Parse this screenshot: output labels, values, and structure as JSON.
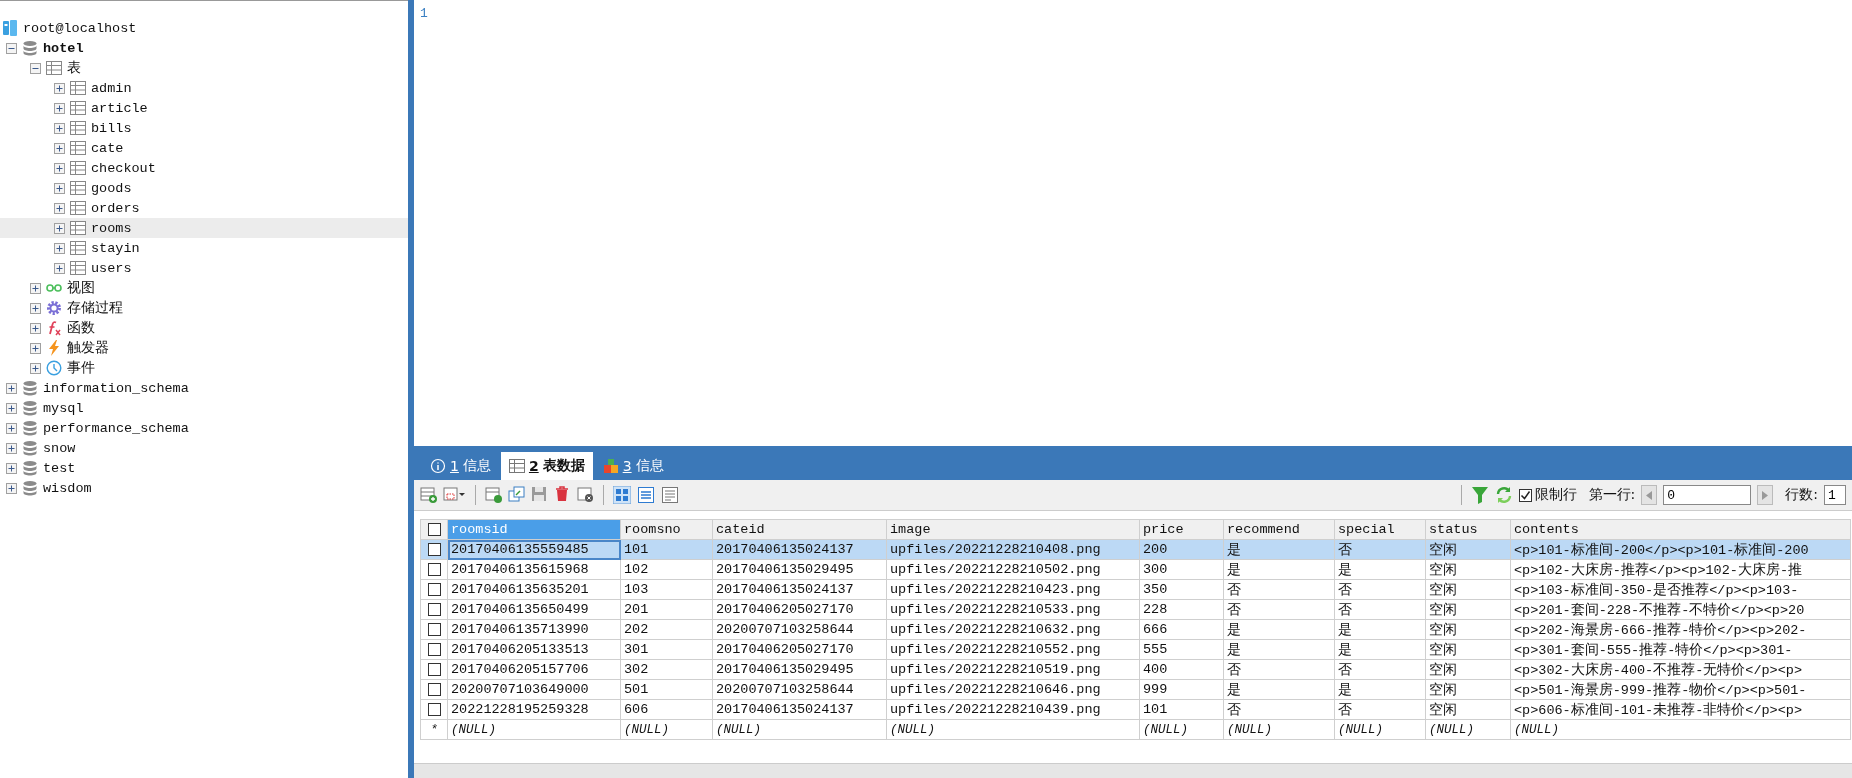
{
  "sidebar": {
    "tree": [
      {
        "kind": "connection",
        "label": "root@localhost",
        "selected": false,
        "children": [
          {
            "kind": "database",
            "label": "hotel",
            "open": true,
            "expanded": true,
            "selected": false,
            "children": [
              {
                "kind": "tables",
                "label": "表",
                "expanded": true,
                "selected": false,
                "children": [
                  {
                    "kind": "table",
                    "label": "admin",
                    "expanded": false,
                    "selected": false
                  },
                  {
                    "kind": "table",
                    "label": "article",
                    "expanded": false,
                    "selected": false
                  },
                  {
                    "kind": "table",
                    "label": "bills",
                    "expanded": false,
                    "selected": false
                  },
                  {
                    "kind": "table",
                    "label": "cate",
                    "expanded": false,
                    "selected": false
                  },
                  {
                    "kind": "table",
                    "label": "checkout",
                    "expanded": false,
                    "selected": false
                  },
                  {
                    "kind": "table",
                    "label": "goods",
                    "expanded": false,
                    "selected": false
                  },
                  {
                    "kind": "table",
                    "label": "orders",
                    "expanded": false,
                    "selected": false
                  },
                  {
                    "kind": "table",
                    "label": "rooms",
                    "expanded": false,
                    "selected": true
                  },
                  {
                    "kind": "table",
                    "label": "stayin",
                    "expanded": false,
                    "selected": false
                  },
                  {
                    "kind": "table",
                    "label": "users",
                    "expanded": false,
                    "selected": false
                  }
                ]
              },
              {
                "kind": "views",
                "label": "视图",
                "expanded": false,
                "selected": false
              },
              {
                "kind": "procedures",
                "label": "存储过程",
                "expanded": false,
                "selected": false
              },
              {
                "kind": "functions",
                "label": "函数",
                "expanded": false,
                "selected": false
              },
              {
                "kind": "triggers",
                "label": "触发器",
                "expanded": false,
                "selected": false
              },
              {
                "kind": "events",
                "label": "事件",
                "expanded": false,
                "selected": false
              }
            ]
          },
          {
            "kind": "database",
            "label": "information_schema",
            "open": false,
            "expanded": false,
            "selected": false
          },
          {
            "kind": "database",
            "label": "mysql",
            "open": false,
            "expanded": false,
            "selected": false
          },
          {
            "kind": "database",
            "label": "performance_schema",
            "open": false,
            "expanded": false,
            "selected": false
          },
          {
            "kind": "database",
            "label": "snow",
            "open": false,
            "expanded": false,
            "selected": false
          },
          {
            "kind": "database",
            "label": "test",
            "open": false,
            "expanded": false,
            "selected": false
          },
          {
            "kind": "database",
            "label": "wisdom",
            "open": false,
            "expanded": false,
            "selected": false
          }
        ]
      }
    ]
  },
  "editor": {
    "line_numbers": [
      "1"
    ]
  },
  "result_tabs": [
    {
      "kind": "info",
      "key": "1",
      "label": "信息",
      "selected": false
    },
    {
      "kind": "data",
      "key": "2",
      "label": "表数据",
      "selected": true
    },
    {
      "kind": "profile",
      "key": "3",
      "label": "信息",
      "selected": false
    }
  ],
  "toolbar": {
    "limit_rows": {
      "label": "限制行",
      "checked": true
    },
    "first_row": {
      "label": "第一行:",
      "value": "0"
    },
    "row_count": {
      "label": "行数:",
      "value": "1"
    }
  },
  "grid": {
    "all_checked": false,
    "columns": [
      {
        "label": "roomsid",
        "selected": true
      },
      {
        "label": "roomsno",
        "selected": false
      },
      {
        "label": "cateid",
        "selected": false
      },
      {
        "label": "image",
        "selected": false
      },
      {
        "label": "price",
        "selected": false
      },
      {
        "label": "recommend",
        "selected": false
      },
      {
        "label": "special",
        "selected": false
      },
      {
        "label": "status",
        "selected": false
      },
      {
        "label": "contents",
        "selected": false
      }
    ],
    "rows": [
      {
        "selected": true,
        "checked": false,
        "cells": [
          "20170406135559485",
          "101",
          "20170406135024137",
          "upfiles/20221228210408.png",
          "200",
          "是",
          "否",
          "空闲",
          "<p>101-标准间-200</p><p>101-标准间-200"
        ]
      },
      {
        "selected": false,
        "checked": false,
        "cells": [
          "20170406135615968",
          "102",
          "20170406135029495",
          "upfiles/20221228210502.png",
          "300",
          "是",
          "是",
          "空闲",
          "<p>102-大床房-推荐</p><p>102-大床房-推"
        ]
      },
      {
        "selected": false,
        "checked": false,
        "cells": [
          "20170406135635201",
          "103",
          "20170406135024137",
          "upfiles/20221228210423.png",
          "350",
          "否",
          "否",
          "空闲",
          "<p>103-标准间-350-是否推荐</p><p>103-"
        ]
      },
      {
        "selected": false,
        "checked": false,
        "cells": [
          "20170406135650499",
          "201",
          "20170406205027170",
          "upfiles/20221228210533.png",
          "228",
          "否",
          "否",
          "空闲",
          "<p>201-套间-228-不推荐-不特价</p><p>20"
        ]
      },
      {
        "selected": false,
        "checked": false,
        "cells": [
          "20170406135713990",
          "202",
          "20200707103258644",
          "upfiles/20221228210632.png",
          "666",
          "是",
          "是",
          "空闲",
          "<p>202-海景房-666-推荐-特价</p><p>202-"
        ]
      },
      {
        "selected": false,
        "checked": false,
        "cells": [
          "20170406205133513",
          "301",
          "20170406205027170",
          "upfiles/20221228210552.png",
          "555",
          "是",
          "是",
          "空闲",
          "<p>301-套间-555-推荐-特价</p><p>301-"
        ]
      },
      {
        "selected": false,
        "checked": false,
        "cells": [
          "20170406205157706",
          "302",
          "20170406135029495",
          "upfiles/20221228210519.png",
          "400",
          "否",
          "否",
          "空闲",
          "<p>302-大床房-400-不推荐-无特价</p><p>"
        ]
      },
      {
        "selected": false,
        "checked": false,
        "cells": [
          "20200707103649000",
          "501",
          "20200707103258644",
          "upfiles/20221228210646.png",
          "999",
          "是",
          "是",
          "空闲",
          "<p>501-海景房-999-推荐-物价</p><p>501-"
        ]
      },
      {
        "selected": false,
        "checked": false,
        "cells": [
          "20221228195259328",
          "606",
          "20170406135024137",
          "upfiles/20221228210439.png",
          "101",
          "否",
          "否",
          "空闲",
          "<p>606-标准间-101-未推荐-非特价</p><p>"
        ]
      }
    ],
    "new_row": {
      "marker": "*",
      "cells": [
        "(NULL)",
        "(NULL)",
        "(NULL)",
        "(NULL)",
        "(NULL)",
        "(NULL)",
        "(NULL)",
        "(NULL)",
        "(NULL)"
      ]
    }
  }
}
